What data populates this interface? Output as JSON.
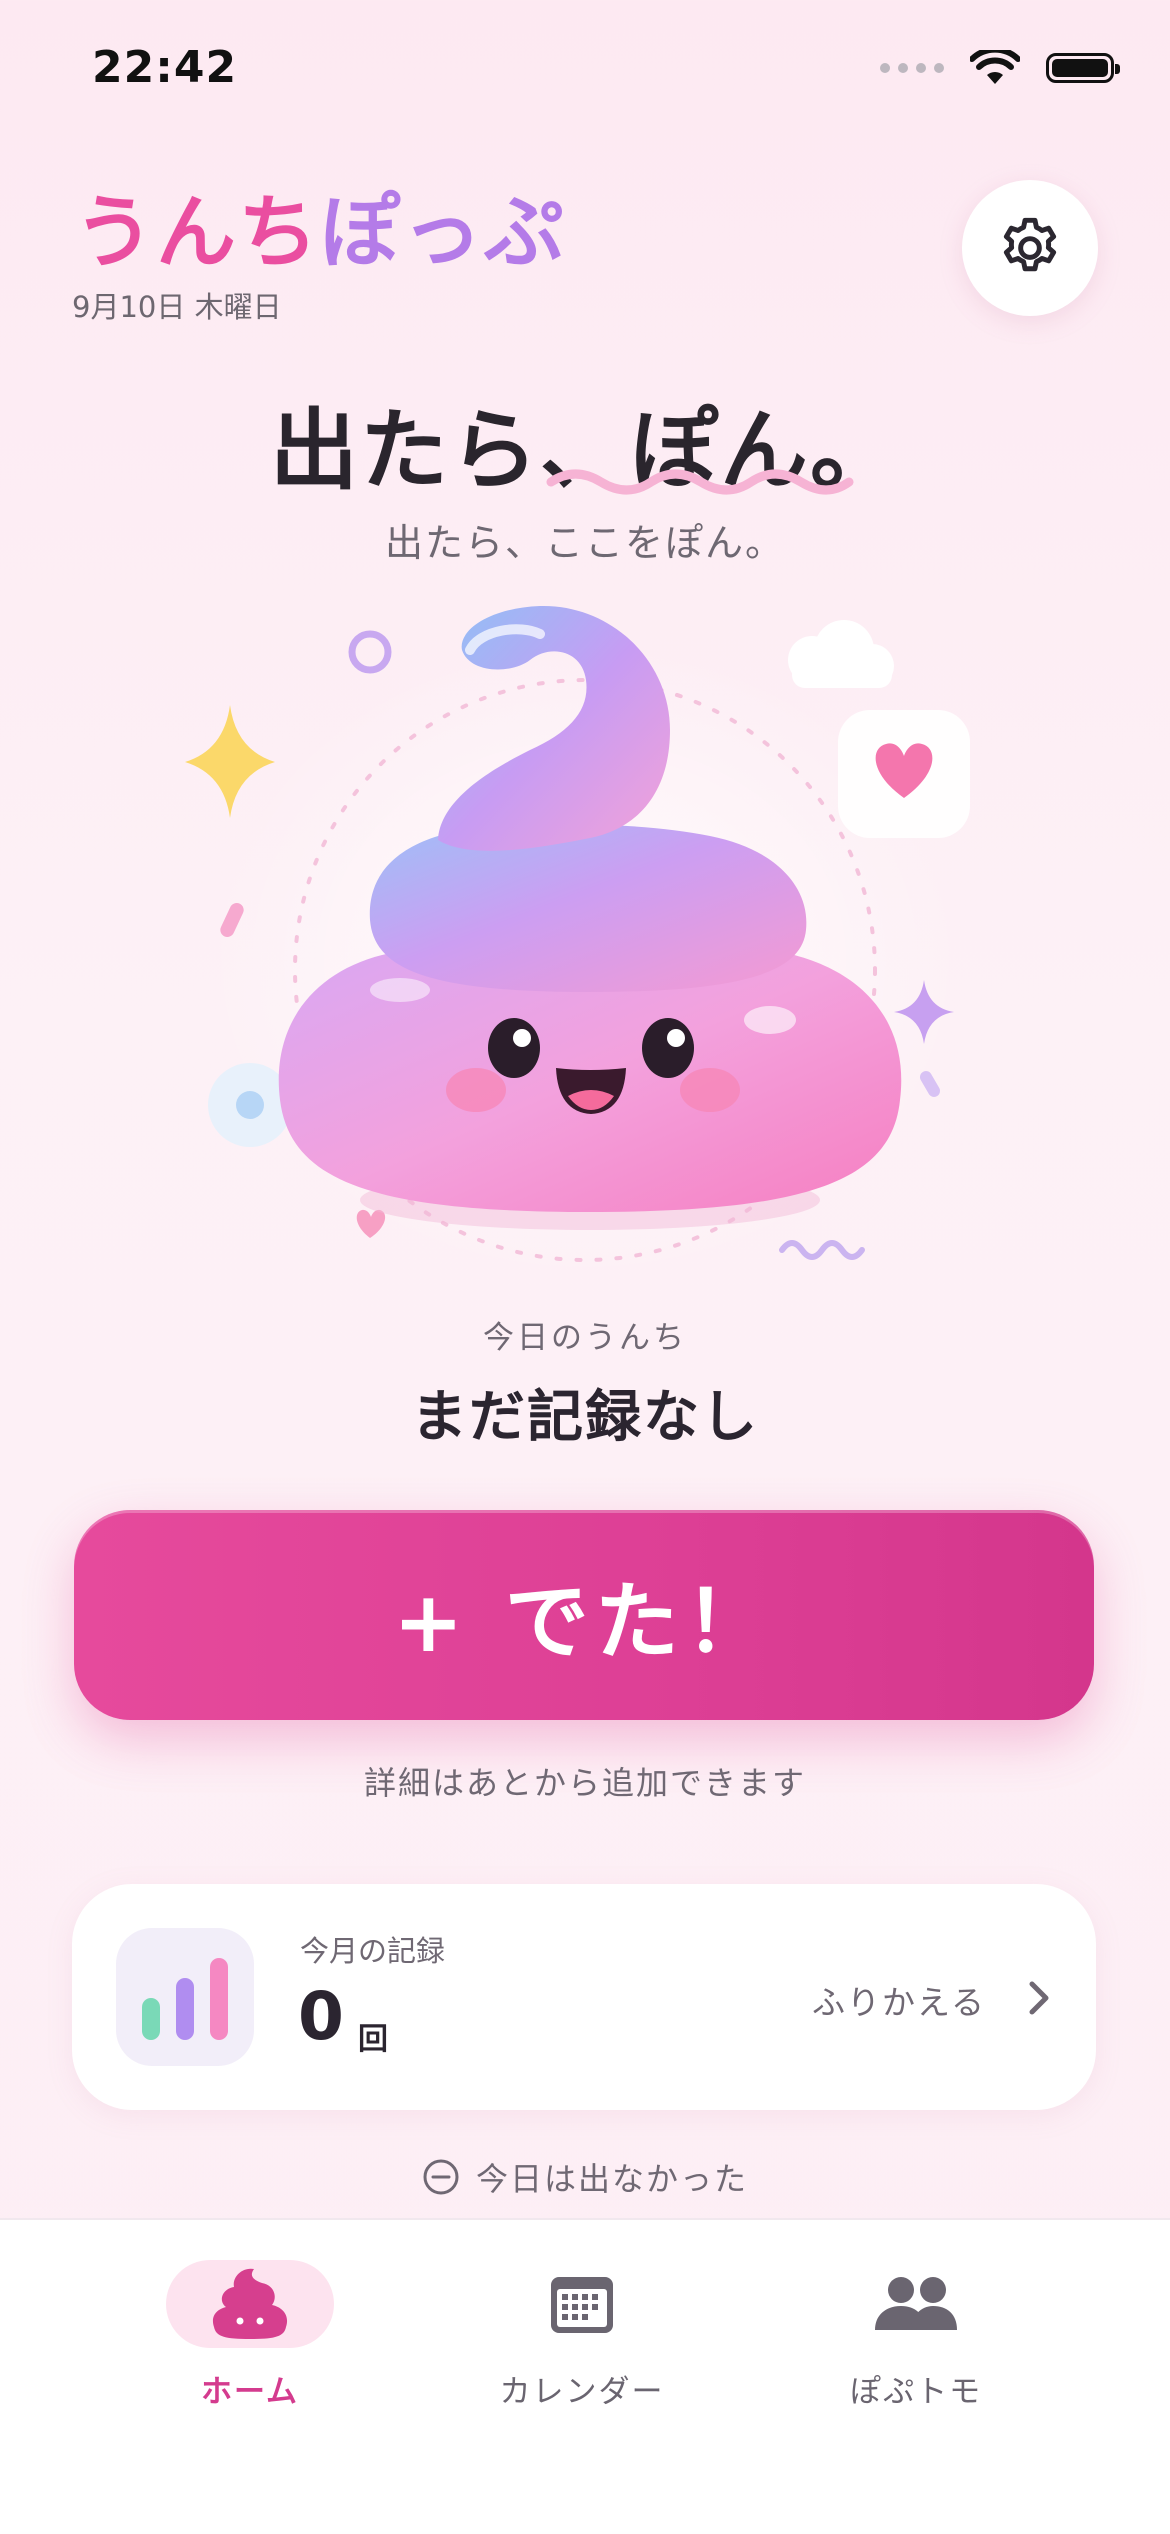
{
  "status_bar": {
    "time": "22:42"
  },
  "header": {
    "title_part1": "うんち",
    "title_part2": "ぽっぷ",
    "date": "9月10日 木曜日"
  },
  "hero": {
    "headline": "出たら、ぽん。",
    "subline": "出たら、ここをぽん。"
  },
  "today": {
    "label": "今日のうんち",
    "value": "まだ記録なし"
  },
  "primary_button": {
    "label": "+ でた！"
  },
  "hint": "詳細はあとから追加できます",
  "monthly": {
    "label": "今月の記録",
    "count": "0",
    "unit": "回",
    "link": "ふりかえる"
  },
  "no_poop_link": "今日は出なかった",
  "tabs": [
    {
      "label": "ホーム",
      "icon": "poop-icon",
      "active": true
    },
    {
      "label": "カレンダー",
      "icon": "calendar-icon",
      "active": false
    },
    {
      "label": "ぽぷトモ",
      "icon": "friends-icon",
      "active": false
    }
  ],
  "colors": {
    "accent": "#e0449a",
    "title_pink": "#ea4ea0",
    "title_purple": "#b47be8"
  }
}
